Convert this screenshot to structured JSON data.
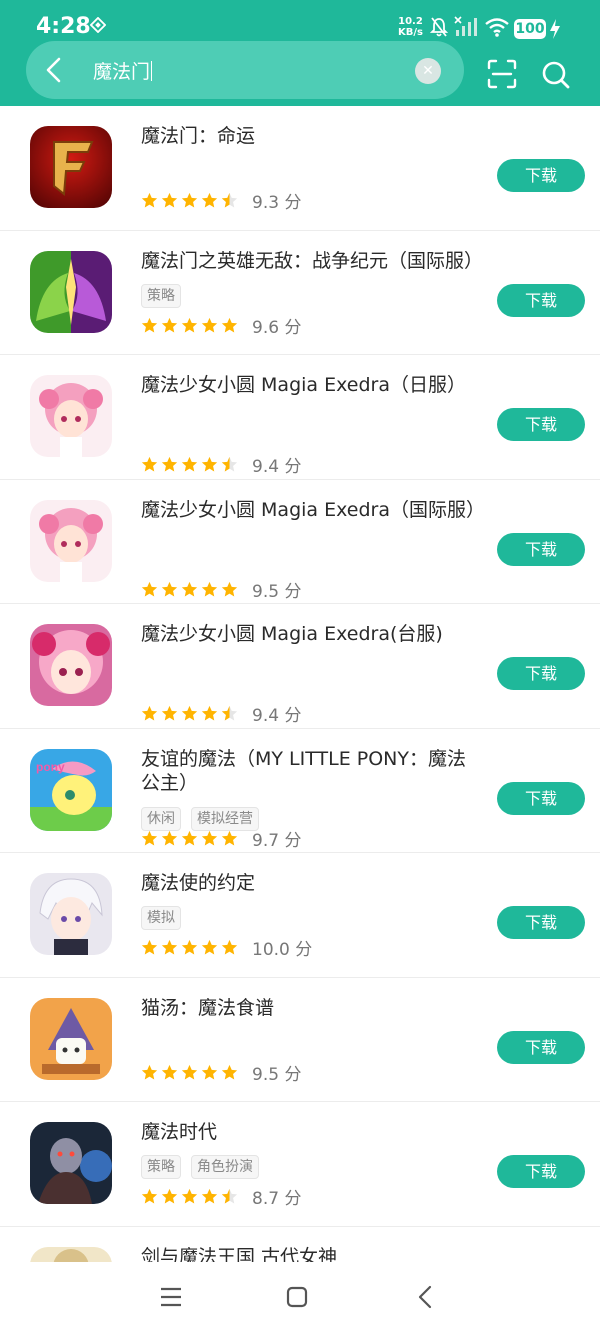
{
  "status_bar": {
    "time": "4:28",
    "net_speed_value": "10.2",
    "net_speed_unit": "KB/s",
    "battery": "100"
  },
  "search": {
    "value": "魔法门"
  },
  "colors": {
    "accent": "#1fb89a",
    "star": "#ffb400"
  },
  "download_label": "下载",
  "apps": [
    {
      "name": "魔法门：命运",
      "tags": [],
      "stars": 4.5,
      "score": "9.3 分",
      "icon": "fantasy-f-logo"
    },
    {
      "name": "魔法门之英雄无敌：战争纪元（国际服）",
      "tags": [
        "策略"
      ],
      "stars": 5,
      "score": "9.6 分",
      "icon": "dragons"
    },
    {
      "name": "魔法少女小圆 Magia Exedra（日服）",
      "tags": [],
      "stars": 4.5,
      "score": "9.4 分",
      "icon": "pink-anime-girl"
    },
    {
      "name": "魔法少女小圆 Magia Exedra（国际服）",
      "tags": [],
      "stars": 5,
      "score": "9.5 分",
      "icon": "pink-anime-girl"
    },
    {
      "name": "魔法少女小圆 Magia Exedra(台服)",
      "tags": [],
      "stars": 4.5,
      "score": "9.4 分",
      "icon": "pink-anime-girl-close"
    },
    {
      "name": "友谊的魔法（MY LITTLE PONY：魔法公主）",
      "tags": [
        "休闲",
        "模拟经营"
      ],
      "stars": 5,
      "score": "9.7 分",
      "icon": "pony"
    },
    {
      "name": "魔法使的约定",
      "tags": [
        "模拟"
      ],
      "stars": 5,
      "score": "10.0 分",
      "icon": "white-hair-anime"
    },
    {
      "name": "猫汤：魔法食谱",
      "tags": [],
      "stars": 5,
      "score": "9.5 分",
      "icon": "cat-wizard"
    },
    {
      "name": "魔法时代",
      "tags": [
        "策略",
        "角色扮演"
      ],
      "stars": 4.5,
      "score": "8.7 分",
      "icon": "dark-warrior"
    },
    {
      "name": "剑与魔法王国 古代女神",
      "tags": [],
      "stars": 0,
      "score": "",
      "icon": "partial"
    }
  ]
}
